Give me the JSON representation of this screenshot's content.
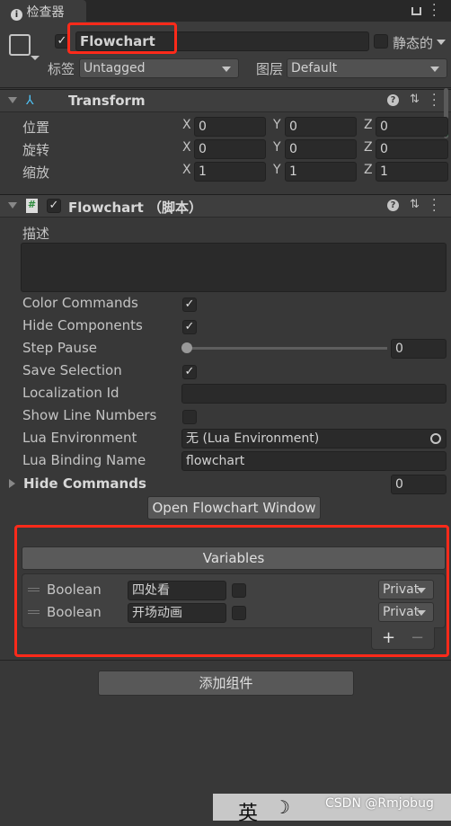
{
  "tab": {
    "icon": "info-icon",
    "title": "检查器",
    "lock_icon": "lock-icon",
    "menu_icon": "kebab-menu-icon"
  },
  "object": {
    "icon": "cube-icon",
    "active": true,
    "name": "Flowchart",
    "static_label": "静态的",
    "static": false,
    "tag_label": "标签",
    "tag": "Untagged",
    "layer_label": "图层",
    "layer": "Default"
  },
  "transform": {
    "title": "Transform",
    "rows": [
      {
        "label": "位置",
        "x": "0",
        "y": "0",
        "z": "0"
      },
      {
        "label": "旋转",
        "x": "0",
        "y": "0",
        "z": "0"
      },
      {
        "label": "缩放",
        "x": "1",
        "y": "1",
        "z": "1"
      }
    ],
    "axis": {
      "x": "X",
      "y": "Y",
      "z": "Z"
    }
  },
  "flowchart": {
    "title": "Flowchart （脚本）",
    "enabled": true,
    "description_label": "描述",
    "description": "",
    "color_commands_label": "Color Commands",
    "color_commands": true,
    "hide_components_label": "Hide Components",
    "hide_components": true,
    "step_pause_label": "Step Pause",
    "step_pause": "0",
    "save_selection_label": "Save Selection",
    "save_selection": true,
    "localization_id_label": "Localization Id",
    "localization_id": "",
    "show_line_numbers_label": "Show Line Numbers",
    "show_line_numbers": false,
    "lua_environment_label": "Lua Environment",
    "lua_environment": "无 (Lua Environment)",
    "lua_binding_label": "Lua Binding Name",
    "lua_binding": "flowchart",
    "hide_commands_label": "Hide Commands",
    "hide_commands": "0",
    "open_window_button": "Open Flowchart Window"
  },
  "variables": {
    "header": "Variables",
    "items": [
      {
        "type": "Boolean",
        "key": "四处看",
        "value": false,
        "scope": "Privat"
      },
      {
        "type": "Boolean",
        "key": "开场动画",
        "value": false,
        "scope": "Privat"
      }
    ],
    "add": "+",
    "remove": "−"
  },
  "add_component_button": "添加组件",
  "ime_bar": {
    "lang": "英",
    "watermark": "CSDN @Rmjobug"
  },
  "colors": {
    "highlight": "#ff2a1a",
    "background": "#383838"
  }
}
